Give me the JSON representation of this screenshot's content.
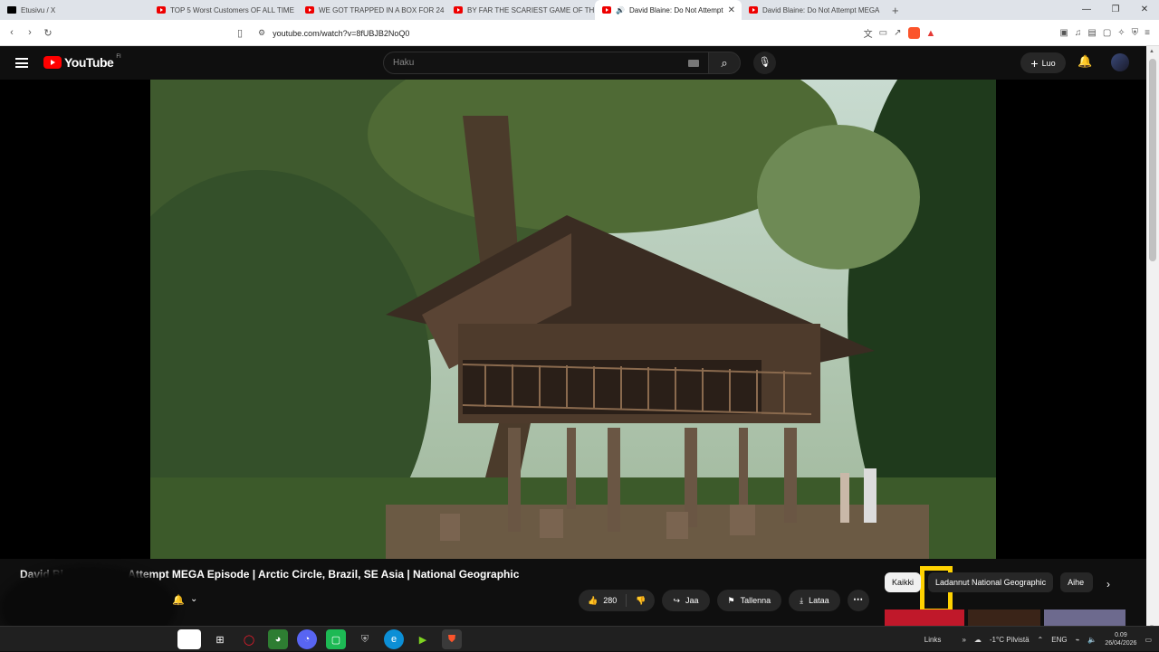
{
  "browser": {
    "tabs": [
      {
        "label": "Etusivu / X",
        "icon": "x-icon",
        "active": false
      },
      {
        "label": "TOP 5 Worst Customers OF ALL TIME",
        "icon": "youtube-icon",
        "active": false
      },
      {
        "label": "WE GOT TRAPPED IN A BOX FOR 24",
        "icon": "youtube-icon",
        "active": false
      },
      {
        "label": "BY FAR THE SCARIEST GAME OF THE",
        "icon": "youtube-icon",
        "active": false
      },
      {
        "label": "David Blaine: Do Not Attempt",
        "icon": "youtube-icon",
        "active": true
      },
      {
        "label": "David Blaine: Do Not Attempt MEGA",
        "icon": "youtube-icon",
        "active": false
      }
    ],
    "url": "youtube.com/watch?v=8fUBJB2NoQ0"
  },
  "youtube": {
    "logo_text": "YouTube",
    "region": "FI",
    "search_placeholder": "Haku",
    "create_label": "Luo"
  },
  "video": {
    "title_visible_a": "David Bl",
    "title_visible_b": "Attempt MEGA Episode | Arctic Circle, Brazil, SE Asia | National Geographic",
    "likes": "280",
    "share_label": "Jaa",
    "save_label": "Tallenna",
    "download_label": "Lataa"
  },
  "chips": [
    "Kaikki",
    "Ladannut National Geographic",
    "Aihe"
  ],
  "taskbar": {
    "links_label": "Links",
    "weather": "-1°C  Pilvistä",
    "lang": "ENG",
    "time": "0.09",
    "date": "26/04/2026"
  }
}
